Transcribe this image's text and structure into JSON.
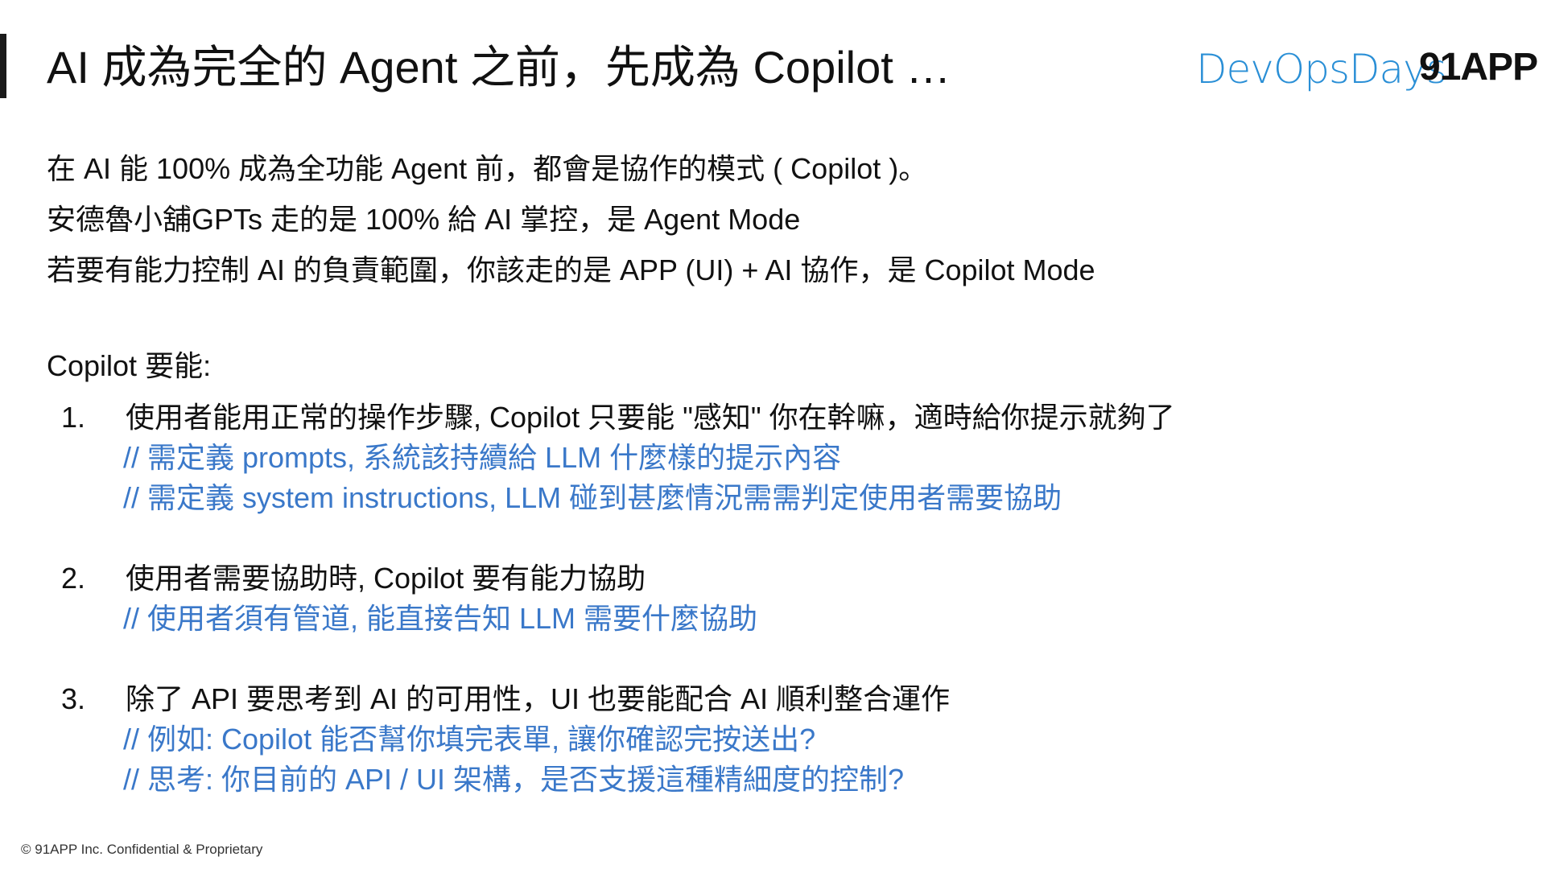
{
  "header": {
    "title": "AI 成為完全的 Agent 之前，先成為 Copilot …",
    "logo_devops": "DevOpsDays",
    "logo_91app": "91APP"
  },
  "intro": [
    "在 AI 能 100% 成為全功能 Agent 前，都會是協作的模式 ( Copilot )。",
    "安德魯小舖GPTs 走的是 100% 給 AI 掌控，是 Agent Mode",
    "若要有能力控制 AI 的負責範圍，你該走的是 APP (UI) + AI 協作，是 Copilot Mode"
  ],
  "section_heading": "Copilot 要能:",
  "items": [
    {
      "number": "1.",
      "text": "使用者能用正常的操作步驟, Copilot 只要能 \"感知\" 你在幹嘛，適時給你提示就夠了",
      "notes": [
        "// 需定義 prompts, 系統該持續給 LLM 什麼樣的提示內容",
        "// 需定義 system instructions, LLM 碰到甚麼情況需需判定使用者需要協助"
      ]
    },
    {
      "number": "2.",
      "text": "使用者需要協助時, Copilot 要有能力協助",
      "notes": [
        "// 使用者須有管道, 能直接告知 LLM 需要什麼協助"
      ]
    },
    {
      "number": "3.",
      "text": "除了 API 要思考到 AI 的可用性，UI 也要能配合 AI 順利整合運作",
      "notes": [
        "// 例如: Copilot 能否幫你填完表單, 讓你確認完按送出?",
        "// 思考: 你目前的 API / UI 架構，是否支援這種精細度的控制?"
      ]
    }
  ],
  "footer": "© 91APP Inc. Confidential & Proprietary",
  "colors": {
    "note_blue": "#3a78c9",
    "devops_blue": "#2a8fd6",
    "text": "#111111"
  }
}
